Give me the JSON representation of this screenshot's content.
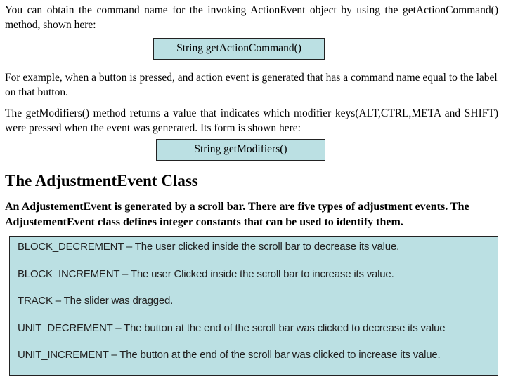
{
  "paragraphs": {
    "command_intro": "You can obtain the command name for the invoking ActionEvent object by using the getActionCommand() method, shown here:",
    "command_example": "For example, when a button is pressed, and action event is generated that has a command name equal to the label on that button.",
    "modifiers_intro": "The getModifiers() method returns a value that indicates which modifier keys(ALT,CTRL,META and SHIFT) were pressed when the event was generated. Its form is shown here:"
  },
  "code_boxes": {
    "get_action_command": "String getActionCommand()",
    "get_modifiers": "String getModifiers()"
  },
  "section": {
    "heading": "The AdjustmentEvent Class",
    "intro": "An AdjustementEvent is generated by a scroll bar. There are five types of adjustment events. The AdjustementEvent class defines integer constants that can be used to identify them."
  },
  "constants": [
    {
      "text": "BLOCK_DECREMENT – The user clicked inside the scroll bar to decrease its value."
    },
    {
      "text": "BLOCK_INCREMENT – The user Clicked inside the scroll bar to increase its value."
    },
    {
      "text": "TRACK – The slider was dragged."
    },
    {
      "text": "UNIT_DECREMENT – The button at the end of the scroll bar was clicked to decrease its value"
    },
    {
      "text": "UNIT_INCREMENT – The button at the end of the scroll bar was clicked to increase its value."
    }
  ],
  "colors": {
    "box_background": "#bbe0e3",
    "box_border": "#222222"
  }
}
